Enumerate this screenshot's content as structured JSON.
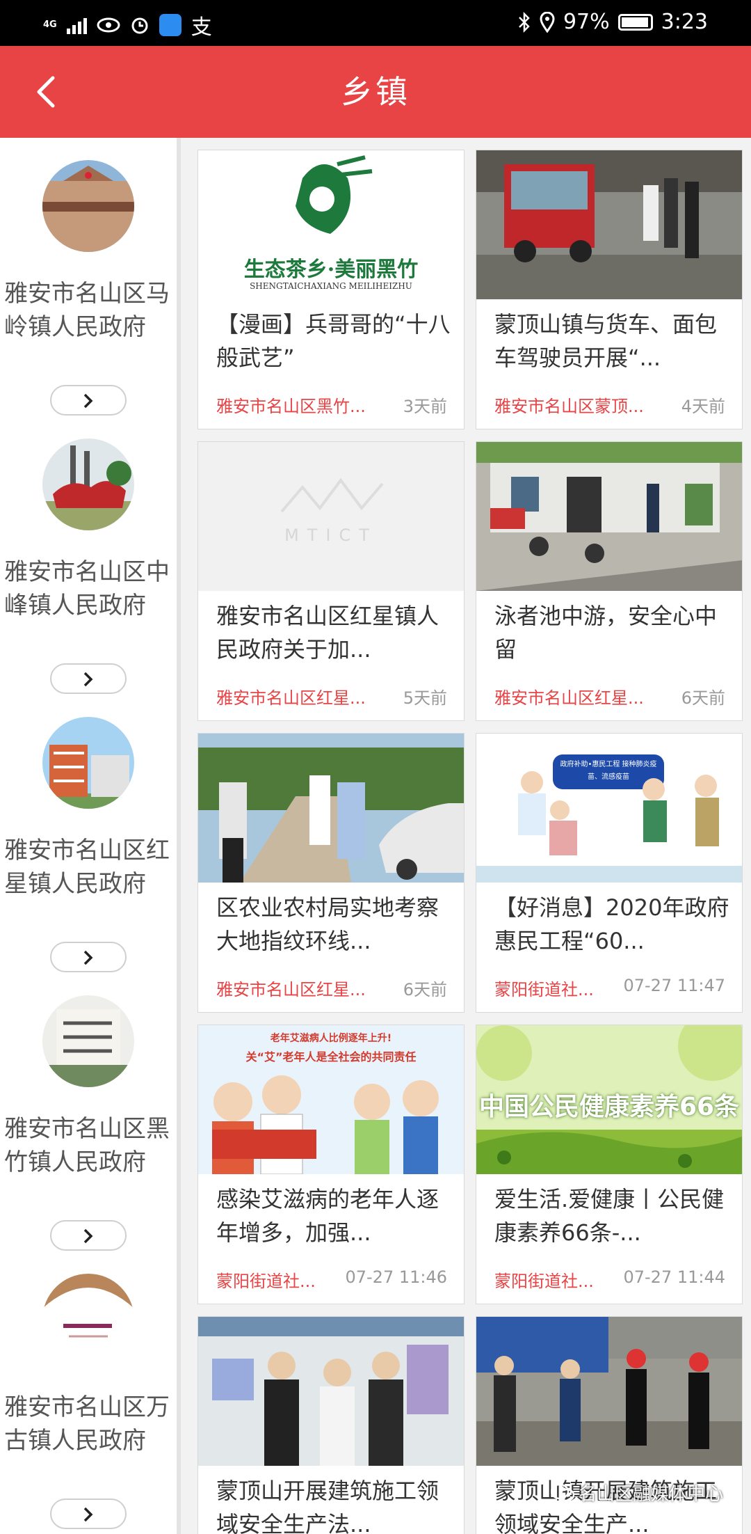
{
  "status": {
    "network": "4G",
    "battery": "97%",
    "time": "3:23",
    "ime": "支"
  },
  "header": {
    "title": "乡镇",
    "back_icon": "chevron-left-icon"
  },
  "colors": {
    "accent": "#e84345",
    "source_text": "#e84345"
  },
  "towns": [
    {
      "name": "雅安市名山区马岭镇人民政府"
    },
    {
      "name": "雅安市名山区中峰镇人民政府"
    },
    {
      "name": "雅安市名山区红星镇人民政府"
    },
    {
      "name": "雅安市名山区黑竹镇人民政府"
    },
    {
      "name": "雅安市名山区万古镇人民政府"
    }
  ],
  "articles": [
    {
      "title": "【漫画】兵哥哥的“十八般武艺”",
      "source": "雅安市名山区黑竹...",
      "time": "3天前",
      "logo_text": "生态茶乡·美丽黑竹",
      "logo_sub": "SHENGTAICHAXIANG MEILIHEIZHU"
    },
    {
      "title": "蒙顶山镇与货车、面包车驾驶员开展“...",
      "source": "雅安市名山区蒙顶...",
      "time": "4天前"
    },
    {
      "title": "雅安市名山区红星镇人民政府关于加...",
      "source": "雅安市名山区红星...",
      "time": "5天前",
      "logo_text": "MTICT"
    },
    {
      "title": "泳者池中游，安全心中留",
      "source": "雅安市名山区红星...",
      "time": "6天前"
    },
    {
      "title": "区农业农村局实地考察大地指纹环线...",
      "source": "雅安市名山区红星...",
      "time": "6天前"
    },
    {
      "title": "【好消息】2020年政府惠民工程“60...",
      "source": "蒙阳街道社...",
      "time": "07-27 11:47",
      "bubble_text": "政府补助•惠民工程 接种肺炎疫苗、流感疫苗"
    },
    {
      "title": "感染艾滋病的老年人逐年增多，加强...",
      "source": "蒙阳街道社...",
      "time": "07-27 11:46",
      "banner_1": "老年艾滋病人比例逐年上升!",
      "banner_2": "关“艾”老年人是全社会的共同责任"
    },
    {
      "title": "爱生活.爱健康丨公民健康素养66条-...",
      "source": "蒙阳街道社...",
      "time": "07-27 11:44",
      "banner": "中国公民健康素养66条"
    },
    {
      "title": "蒙顶山开展建筑施工领域安全生产法...",
      "source": "",
      "time": ""
    },
    {
      "title": "蒙顶山镇开展建筑施工领域安全生产...",
      "source": "",
      "time": ""
    }
  ],
  "watermark": "名山区融媒体中心"
}
